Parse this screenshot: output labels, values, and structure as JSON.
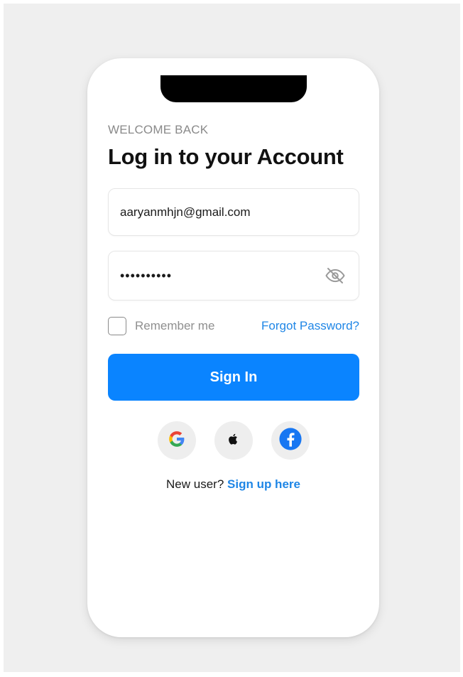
{
  "login": {
    "eyebrow": "WELCOME BACK",
    "title": "Log in to your Account",
    "email_value": "aaryanmhjn@gmail.com",
    "password_value": "••••••••••",
    "password_toggle_icon": "eye-slash-icon",
    "remember_label": "Remember me",
    "remember_checked": false,
    "forgot_label": "Forgot Password?",
    "signin_label": "Sign In",
    "social_providers": [
      "google-icon",
      "apple-icon",
      "facebook-icon"
    ],
    "signup_prompt": "New user?",
    "signup_link": "Sign up here"
  },
  "colors": {
    "primary": "#0a84ff",
    "link": "#1f86e6",
    "facebook": "#1877f2",
    "muted_text": "#8a8a8a",
    "page_bg": "#efefef"
  }
}
